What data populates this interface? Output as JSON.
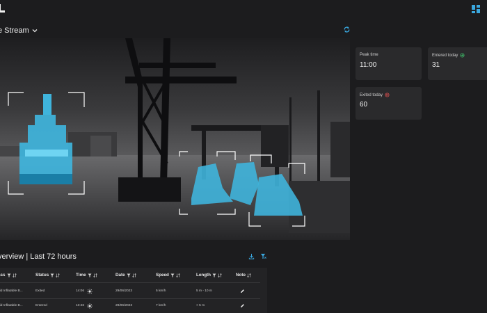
{
  "header": {
    "brand_icon": "building-logo-icon",
    "layout_icon": "grid-layout-icon",
    "accent": "#3aa8e0"
  },
  "stream": {
    "title": "e Stream",
    "dropdown_icon": "chevron-down-icon",
    "refresh_icon": "refresh-icon"
  },
  "stats": [
    {
      "label": "Peak time",
      "value": "11:00",
      "icon": ""
    },
    {
      "label": "Entered today",
      "value": "31",
      "icon": "entered-icon",
      "icon_color": "#3fbf6a"
    },
    {
      "label": "Exited today",
      "value": "60",
      "icon": "exited-icon",
      "icon_color": "#e05050"
    }
  ],
  "overview": {
    "title": "verview | Last 72 hours",
    "download_icon": "download-icon",
    "clear_filter_icon": "filter-clear-icon"
  },
  "table": {
    "columns": [
      "ass",
      "Status",
      "Time",
      "Date",
      "Speed",
      "Length",
      "Note"
    ],
    "rows": [
      {
        "class": "gid Inflatable B...",
        "status": "Exited",
        "time": "14:06",
        "time_icon": "sun-icon",
        "date": "29/06/2023",
        "speed": "5 km/h",
        "length": "5 m - 10 m",
        "note_icon": "edit-icon"
      },
      {
        "class": "gid Inflatable B...",
        "status": "Entered",
        "time": "13:46",
        "time_icon": "sun-icon",
        "date": "29/06/2023",
        "speed": "7 km/h",
        "length": "< 5 m",
        "note_icon": "edit-icon"
      }
    ]
  }
}
